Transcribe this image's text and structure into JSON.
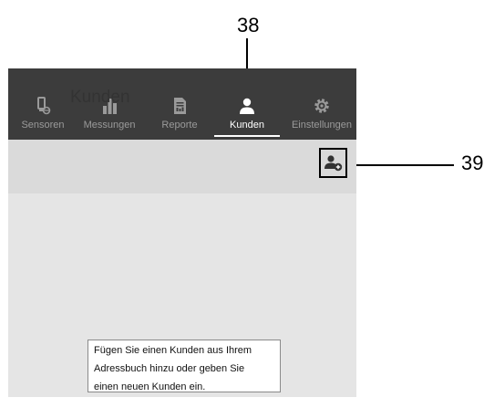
{
  "annotations": {
    "label_38": "38",
    "label_39": "39"
  },
  "nav": {
    "items": [
      {
        "label": "Sensoren",
        "icon": "sensor-icon"
      },
      {
        "label": "Messungen",
        "icon": "bar-chart-icon"
      },
      {
        "label": "Reporte",
        "icon": "report-icon"
      },
      {
        "label": "Kunden",
        "icon": "person-icon",
        "active": true
      },
      {
        "label": "Einstellungen",
        "icon": "gear-icon"
      }
    ]
  },
  "header": {
    "title": "Kunden",
    "add_button_icon": "add-customer-icon"
  },
  "tooltip": {
    "line1": "Fügen Sie einen Kunden aus Ihrem",
    "line2": "Adressbuch hinzu oder geben Sie",
    "line3": "einen neuen Kunden ein."
  },
  "colors": {
    "nav_bg": "#3c3c3c",
    "nav_inactive": "#9a9a9a",
    "nav_active": "#ffffff",
    "header_bg": "#dadada",
    "content_bg": "#e5e5e5"
  }
}
